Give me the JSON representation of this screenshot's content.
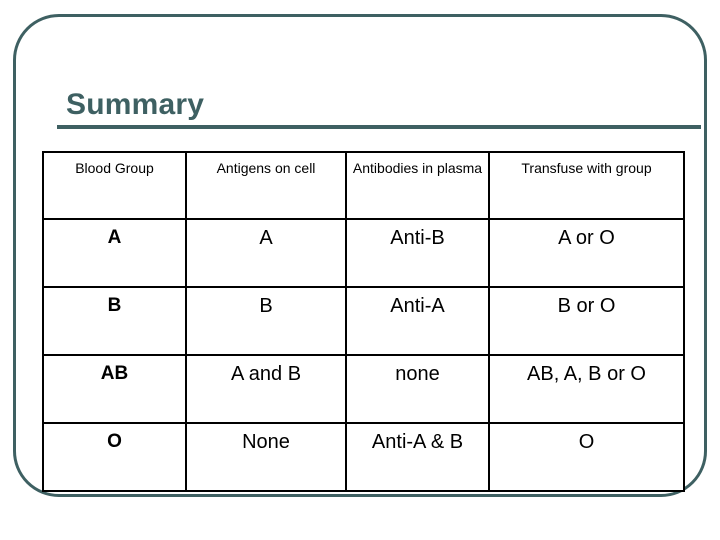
{
  "slide": {
    "title": "Summary",
    "frame_color": "#3e6062",
    "accent_color": "#3e6062",
    "background_color": "#ffffff",
    "table_border_color": "#000000"
  },
  "table": {
    "headers": [
      "Blood Group",
      "Antigens on cell",
      "Antibodies in plasma",
      "Transfuse with group"
    ],
    "rows": [
      {
        "blood_group": "A",
        "antigens_on_cell": "A",
        "antibodies_in_plasma": "Anti-B",
        "transfuse_with_group": "A or O"
      },
      {
        "blood_group": "B",
        "antigens_on_cell": "B",
        "antibodies_in_plasma": "Anti-A",
        "transfuse_with_group": "B or O"
      },
      {
        "blood_group": "AB",
        "antigens_on_cell": "A and B",
        "antibodies_in_plasma": "none",
        "transfuse_with_group": "AB, A, B or O"
      },
      {
        "blood_group": "O",
        "antigens_on_cell": "None",
        "antibodies_in_plasma": "Anti-A & B",
        "transfuse_with_group": "O"
      }
    ]
  }
}
